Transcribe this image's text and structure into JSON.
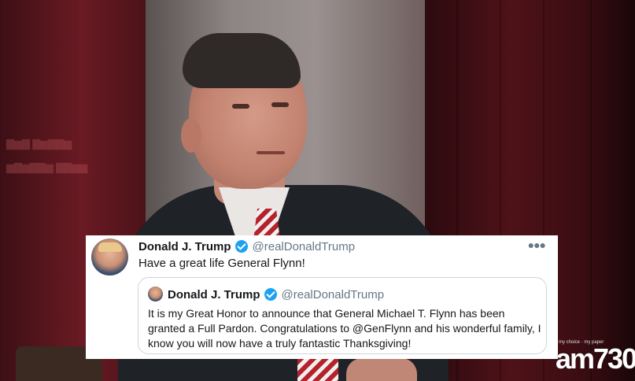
{
  "tweet": {
    "display_name": "Donald J. Trump",
    "handle": "@realDonaldTrump",
    "text": "Have a great life General Flynn!",
    "more_icon": "more-options-icon",
    "quoted": {
      "display_name": "Donald J. Trump",
      "handle": "@realDonaldTrump",
      "text": "It is my Great Honor to announce that General Michael T. Flynn has been granted a Full Pardon. Congratulations to @GenFlynn and his wonderful family, I know you will now have a truly fantastic Thanksgiving!"
    }
  },
  "watermark": {
    "logo": "am730",
    "tagline": "my choice · my paper"
  },
  "colors": {
    "verified": "#1da1f2",
    "handle_gray": "#657786",
    "text": "#14171a",
    "quote_border": "#ccd6dd",
    "background_red": "#4e1218"
  }
}
